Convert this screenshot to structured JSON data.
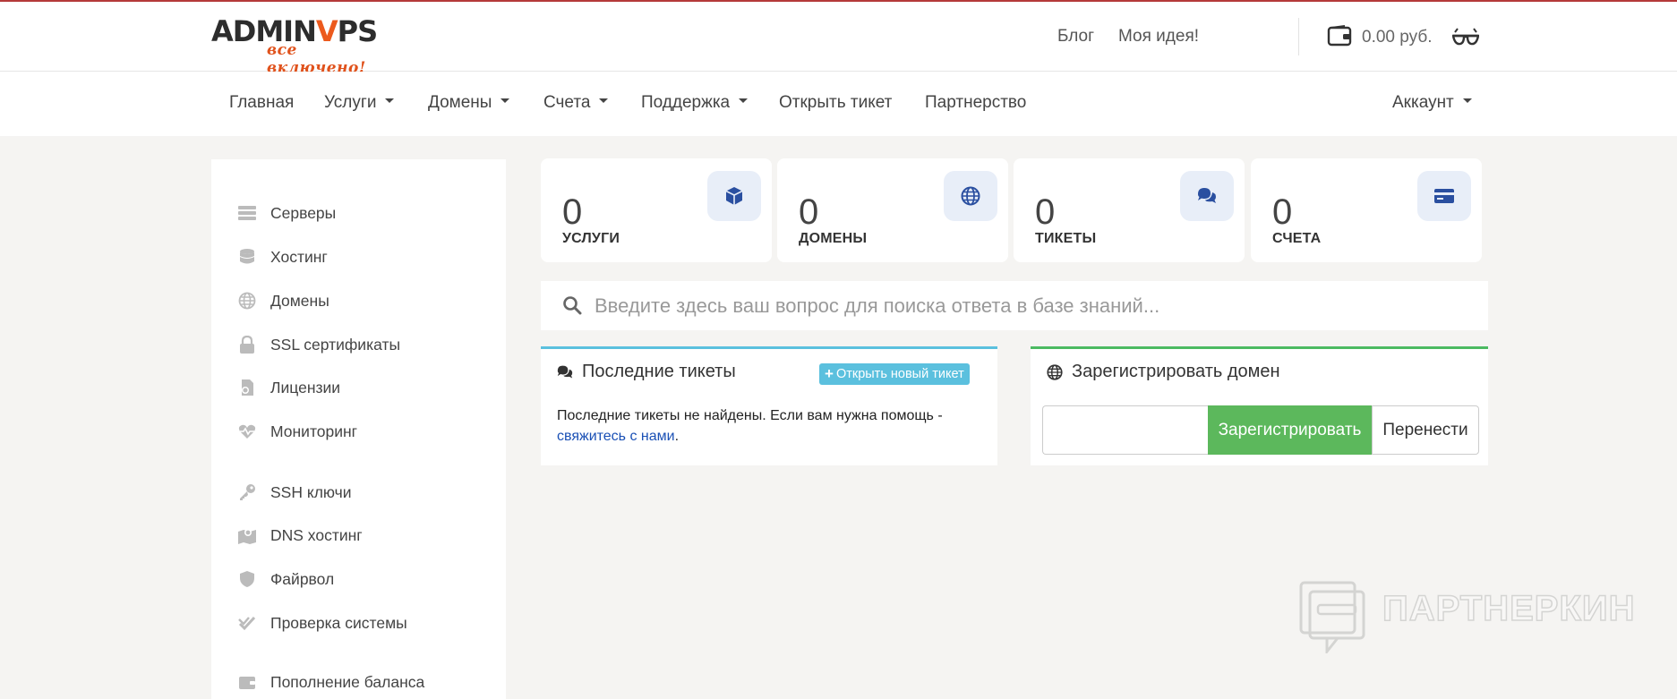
{
  "colors": {
    "accent_orange": "#ec5a1d",
    "green": "#5cb85c",
    "info": "#5bc0de",
    "link": "#1a50b5",
    "topbar_border": "#b53a3a"
  },
  "logo": {
    "prefix": "ADMIN",
    "accent": "V",
    "suffix": "PS",
    "tagline": "все включено!"
  },
  "header": {
    "links": [
      {
        "label": "Блог"
      },
      {
        "label": "Моя идея!"
      }
    ],
    "balance": "0.00 руб.",
    "wallet_icon": "wallet-icon",
    "glasses_icon": "glasses-icon"
  },
  "nav": {
    "items": [
      {
        "label": "Главная",
        "dropdown": false
      },
      {
        "label": "Услуги",
        "dropdown": true
      },
      {
        "label": "Домены",
        "dropdown": true
      },
      {
        "label": "Счета",
        "dropdown": true
      },
      {
        "label": "Поддержка",
        "dropdown": true
      },
      {
        "label": "Открыть тикет",
        "dropdown": false
      },
      {
        "label": "Партнерство",
        "dropdown": false
      }
    ],
    "account": "Аккаунт"
  },
  "sidebar": {
    "items": [
      {
        "label": "Серверы",
        "icon": "server-icon"
      },
      {
        "label": "Хостинг",
        "icon": "database-icon"
      },
      {
        "label": "Домены",
        "icon": "globe-icon"
      },
      {
        "label": "SSL сертификаты",
        "icon": "lock-icon"
      },
      {
        "label": "Лицензии",
        "icon": "license-icon"
      },
      {
        "label": "Мониторинг",
        "icon": "heartbeat-icon"
      },
      {
        "label": "SSH ключи",
        "icon": "key-icon"
      },
      {
        "label": "DNS хостинг",
        "icon": "map-marker-icon"
      },
      {
        "label": "Файрвол",
        "icon": "shield-icon"
      },
      {
        "label": "Проверка системы",
        "icon": "check-icon"
      },
      {
        "label": "Пополнение баланса",
        "icon": "wallet-icon"
      }
    ]
  },
  "stats": [
    {
      "value": "0",
      "label": "УСЛУГИ",
      "icon": "cube-icon"
    },
    {
      "value": "0",
      "label": "ДОМЕНЫ",
      "icon": "globe-icon"
    },
    {
      "value": "0",
      "label": "ТИКЕТЫ",
      "icon": "comments-icon"
    },
    {
      "value": "0",
      "label": "СЧЕТА",
      "icon": "credit-card-icon"
    }
  ],
  "search": {
    "placeholder": "Введите здесь ваш вопрос для поиска ответа в базе знаний..."
  },
  "tickets_panel": {
    "title": "Последние тикеты",
    "new_ticket_button": "Открыть новый тикет",
    "empty_text": "Последние тикеты не найдены. Если вам нужна помощь -",
    "contact_link": "свяжитесь с нами",
    "contact_suffix": "."
  },
  "domain_panel": {
    "title": "Зарегистрировать домен",
    "register_button": "Зарегистрировать",
    "transfer_button": "Перенести",
    "input_value": ""
  },
  "watermark": {
    "text": "ПАРТНЕРКИН"
  }
}
